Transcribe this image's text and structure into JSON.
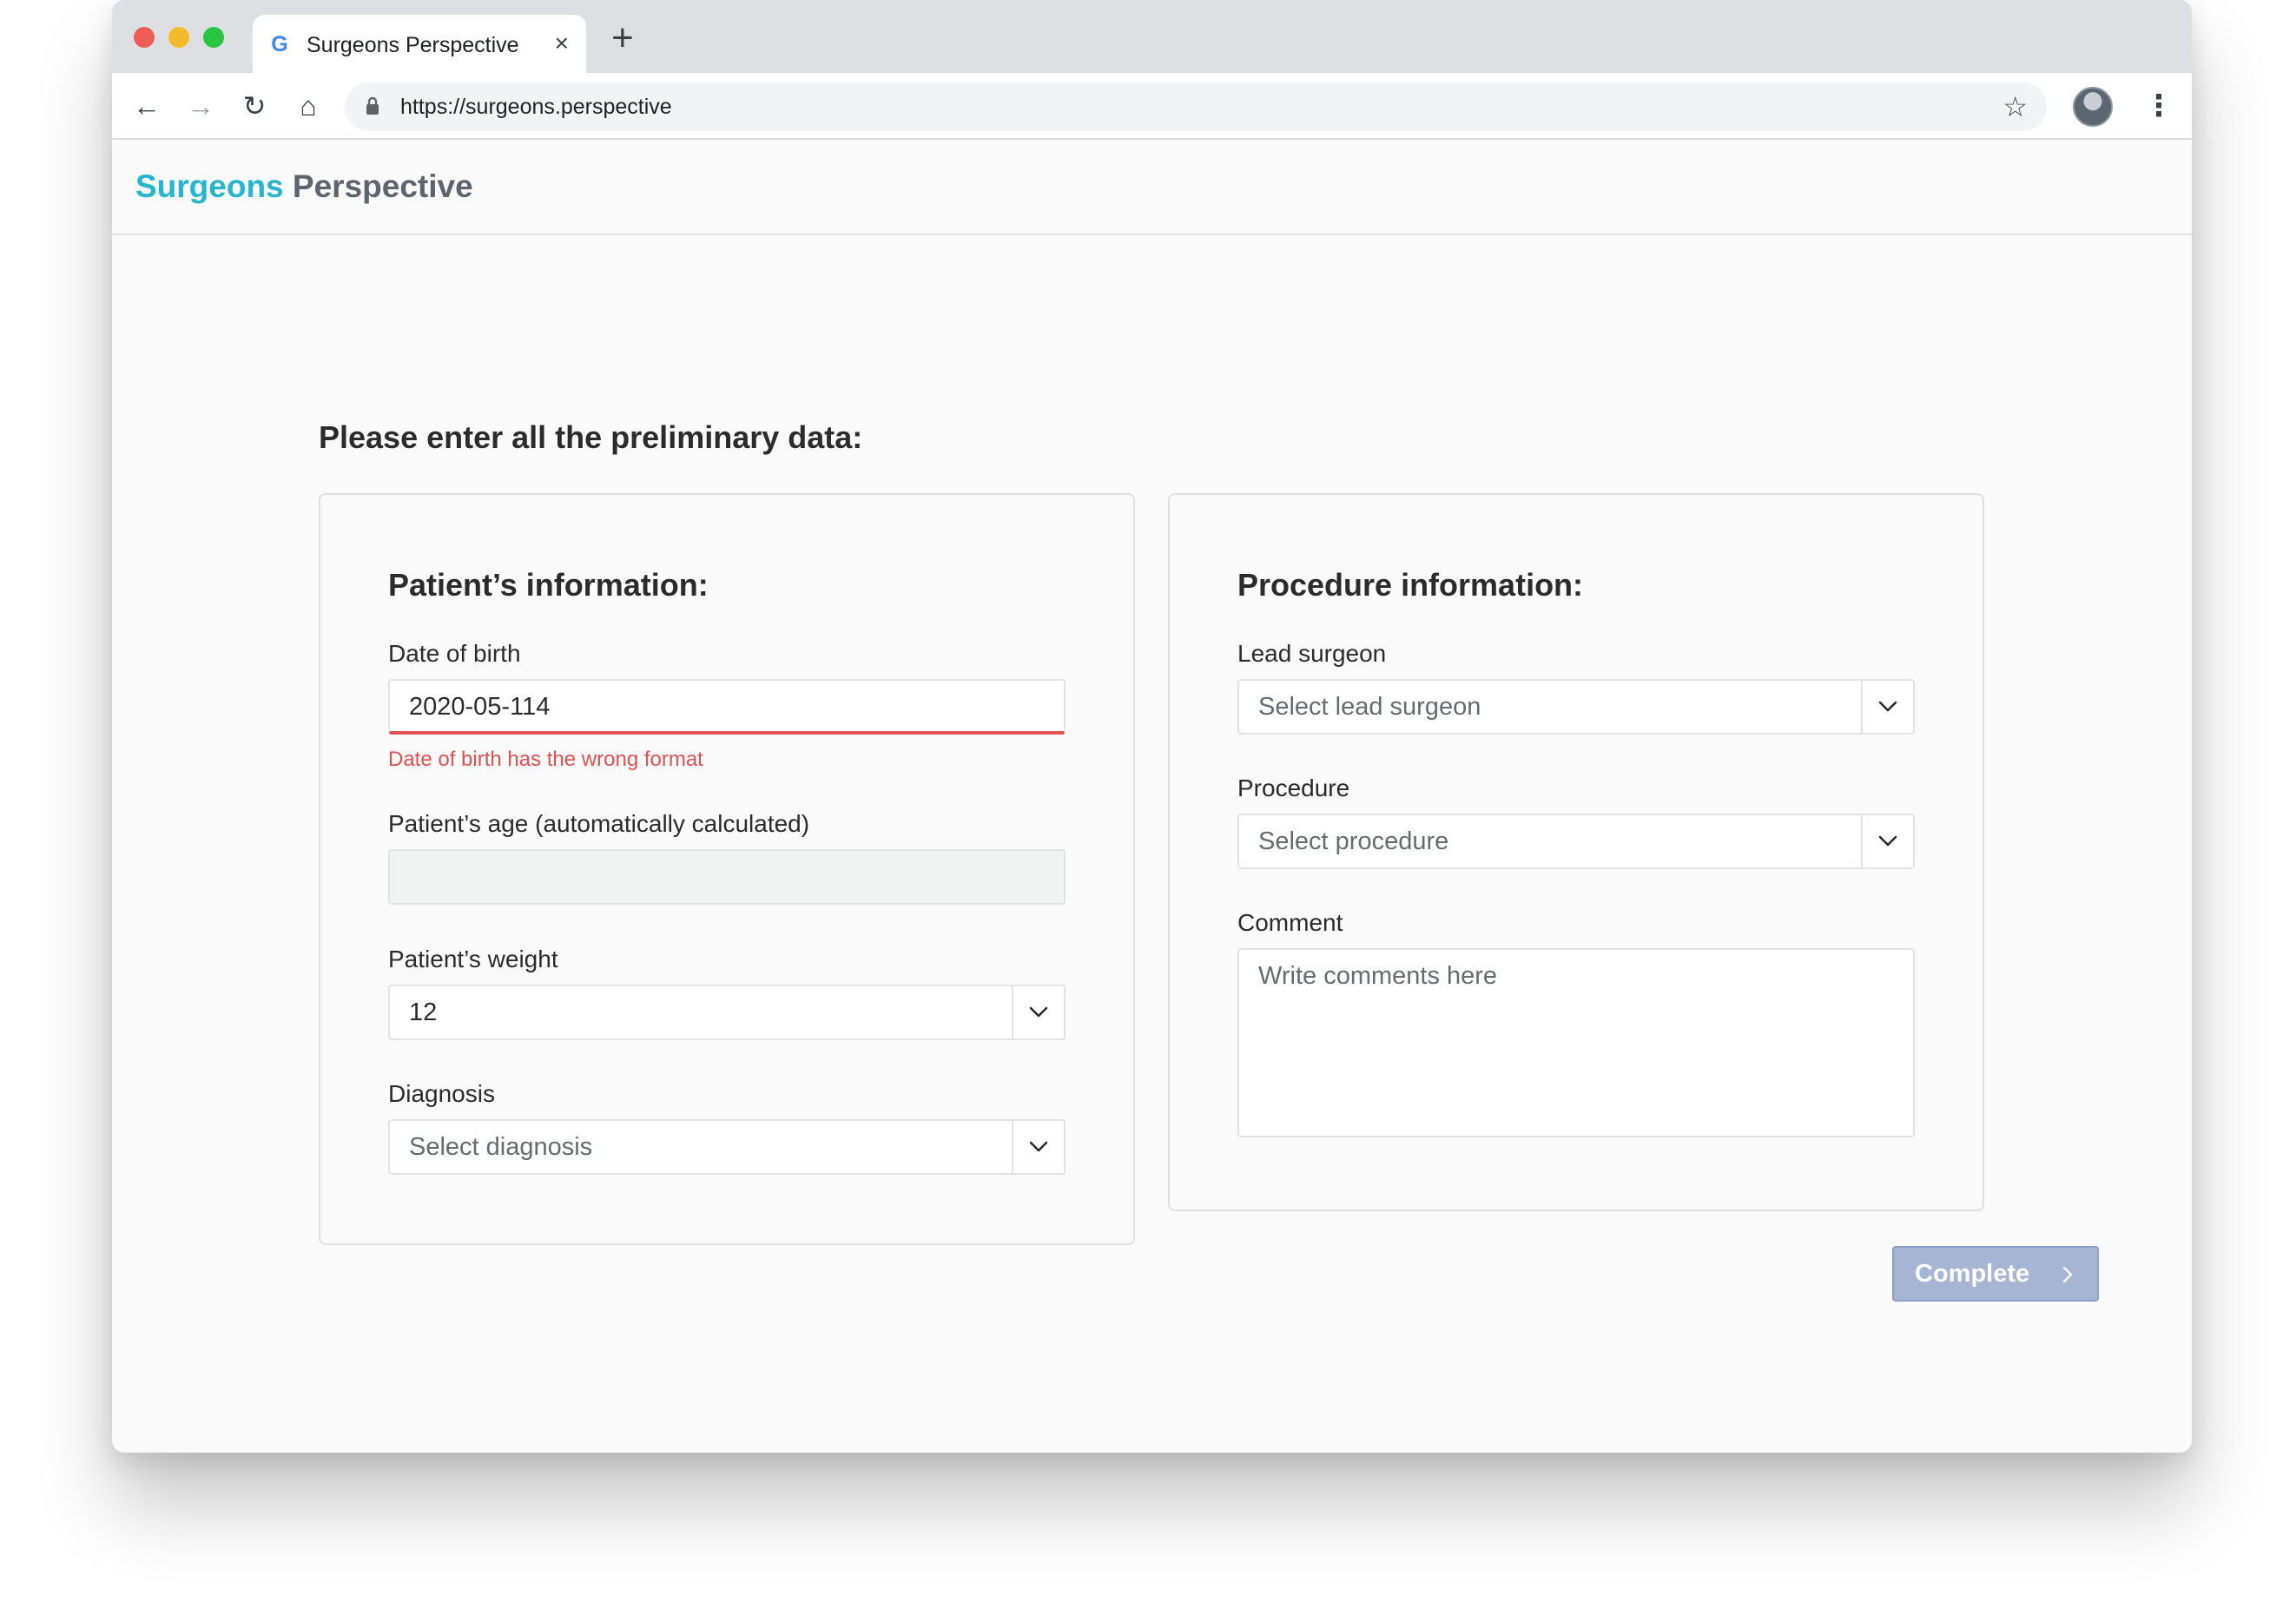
{
  "browser": {
    "tab_title": "Surgeons Perspective",
    "tab_close": "×",
    "new_tab": "+",
    "url": "https://surgeons.perspective",
    "icons": {
      "back": "←",
      "forward": "→",
      "reload": "↻",
      "home": "⌂",
      "star": "☆",
      "menu": "⋮",
      "favicon": "G"
    }
  },
  "app": {
    "brand_part1": "Surgeons",
    "brand_part2": "Perspective",
    "brand_colors": {
      "accent": "#26b5cf",
      "secondary": "#5d6470"
    }
  },
  "page": {
    "heading": "Please enter all the preliminary data:"
  },
  "patient": {
    "title": "Patient’s information:",
    "dob_label": "Date of birth",
    "dob_value": "2020-05-114",
    "dob_error": "Date of birth has the wrong format",
    "age_label": "Patient’s age (automatically calculated)",
    "age_value": "",
    "weight_label": "Patient’s weight",
    "weight_value": "12",
    "diagnosis_label": "Diagnosis",
    "diagnosis_placeholder": "Select diagnosis"
  },
  "procedure": {
    "title": "Procedure information:",
    "surgeon_label": "Lead surgeon",
    "surgeon_placeholder": "Select lead surgeon",
    "procedure_label": "Procedure",
    "procedure_placeholder": "Select procedure",
    "comment_label": "Comment",
    "comment_placeholder": "Write comments here"
  },
  "actions": {
    "complete_label": "Complete"
  },
  "colors": {
    "error": "#e05252",
    "button_disabled": "#a6b5d4"
  }
}
